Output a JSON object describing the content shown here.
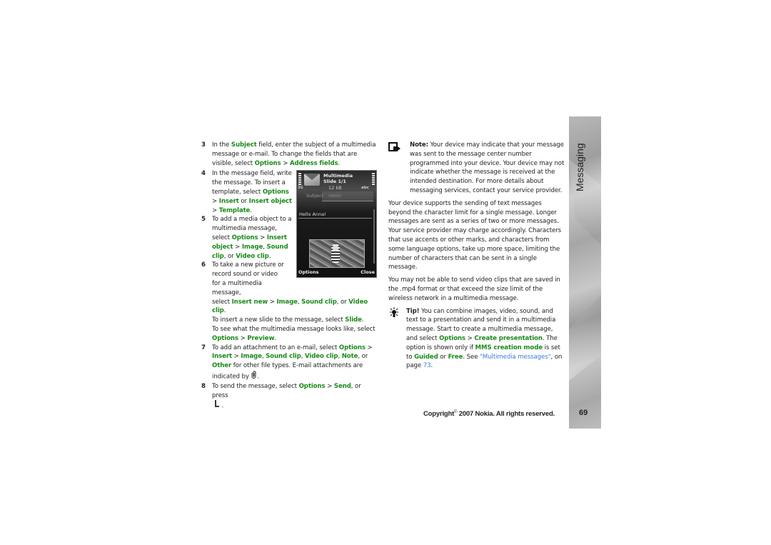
{
  "section": {
    "title": "Messaging",
    "page_number": "69"
  },
  "footer": {
    "copyright_prefix": "Copyright",
    "copyright_symbol": "©",
    "copyright_text": "2007 Nokia. All rights reserved."
  },
  "left_column": {
    "step3": {
      "num": "3",
      "t1": "In the ",
      "k1": "Subject",
      "t2": " field, enter the subject of a multimedia message or e-mail. To change the fields that are visible, select ",
      "k2": "Options",
      "sep": " > ",
      "k3": "Address fields",
      "end": "."
    },
    "step4": {
      "num": "4",
      "t1": "In the message field, write the message. To insert a template, select ",
      "k1": "Options",
      "sep1": " > ",
      "k2": "Insert",
      "or": " or ",
      "k3": "Insert object",
      "sep2": " > ",
      "k4": "Template",
      "end": "."
    },
    "step5": {
      "num": "5",
      "t1": "To add a media object to a multimedia message, select ",
      "k1": "Options",
      "sep1": " > ",
      "k2": "Insert object",
      "sep2": " > ",
      "k3": "Image",
      "comma": ", ",
      "k4": "Sound clip",
      "or": ", or ",
      "k5": "Video clip",
      "end": "."
    },
    "step6": {
      "num": "6",
      "t1": "To take a new picture or record sound or video for a multimedia message,",
      "t2": "select ",
      "k1": "Insert new",
      "sep1": " > ",
      "k2": "Image",
      "comma": ", ",
      "k3": "Sound clip",
      "or": ", or ",
      "k4": "Video clip",
      "end": ".",
      "t3": "To insert a new slide to the message, select ",
      "k5": "Slide",
      "end2": ".",
      "t4": "To see what the multimedia message looks like, select ",
      "k6": "Options",
      "sep2": " > ",
      "k7": "Preview",
      "end3": "."
    },
    "step7": {
      "num": "7",
      "t1": "To add an attachment to an e-mail, select ",
      "k1": "Options",
      "sep1": " > ",
      "k2": "Insert",
      "sep2": " > ",
      "k3": "Image",
      "c1": ", ",
      "k4": "Sound clip",
      "c2": ", ",
      "k5": "Video clip",
      "c3": ", ",
      "k6": "Note",
      "or": ", or ",
      "k7": "Other",
      "t2": " for other file types. E-mail attachments are indicated by ",
      "icon": "paperclip-icon",
      "end": "."
    },
    "step8": {
      "num": "8",
      "t1": "To send the message, select ",
      "k1": "Options",
      "sep": " > ",
      "k2": "Send",
      "t2": ", or press ",
      "icon": "call-key-icon",
      "end": "."
    }
  },
  "phone_screen": {
    "title": "Multimedia",
    "slide": "Slide 1/1",
    "size": "12 kB",
    "network": "3G",
    "input_mode": "abc",
    "subject_label": "Subject",
    "subject_value": "Hello!",
    "message_text": "Hello Anna!",
    "left_softkey": "Options",
    "right_softkey": "Close"
  },
  "right_column": {
    "note": {
      "label": "Note:",
      "text": " Your device may indicate that your message was sent to the message center number programmed into your device. Your device may not indicate whether the message is received at the intended destination. For more details about messaging services, contact your service provider."
    },
    "para1": "Your device supports the sending of text messages beyond the character limit for a single message. Longer messages are sent as a series of two or more messages. Your service provider may charge accordingly. Characters that use accents or other marks, and characters from some language options, take up more space, limiting the number of characters that can be sent in a single message.",
    "para2": "You may not be able to send video clips that are saved in the .mp4 format or that exceed the size limit of the wireless network in a multimedia message.",
    "tip": {
      "label": "Tip!",
      "t1": " You can combine images, video, sound, and text to a presentation and send it in a multimedia message. Start to create a multimedia message, and select ",
      "k1": "Options",
      "sep": " > ",
      "k2": "Create presentation",
      "t2": ". The option is shown only if ",
      "k3": "MMS creation mode",
      "t3": " is set to ",
      "k4": "Guided",
      "or": " or ",
      "k5": "Free",
      "t4": ". See ",
      "link": "\"Multimedia messages\"",
      "t5": ", on page ",
      "page": "73",
      "end": "."
    }
  },
  "colors": {
    "keyword_green": "#1a8a1a",
    "link_blue": "#3a7be0",
    "sidebar_gray": "#b5b5b5"
  }
}
